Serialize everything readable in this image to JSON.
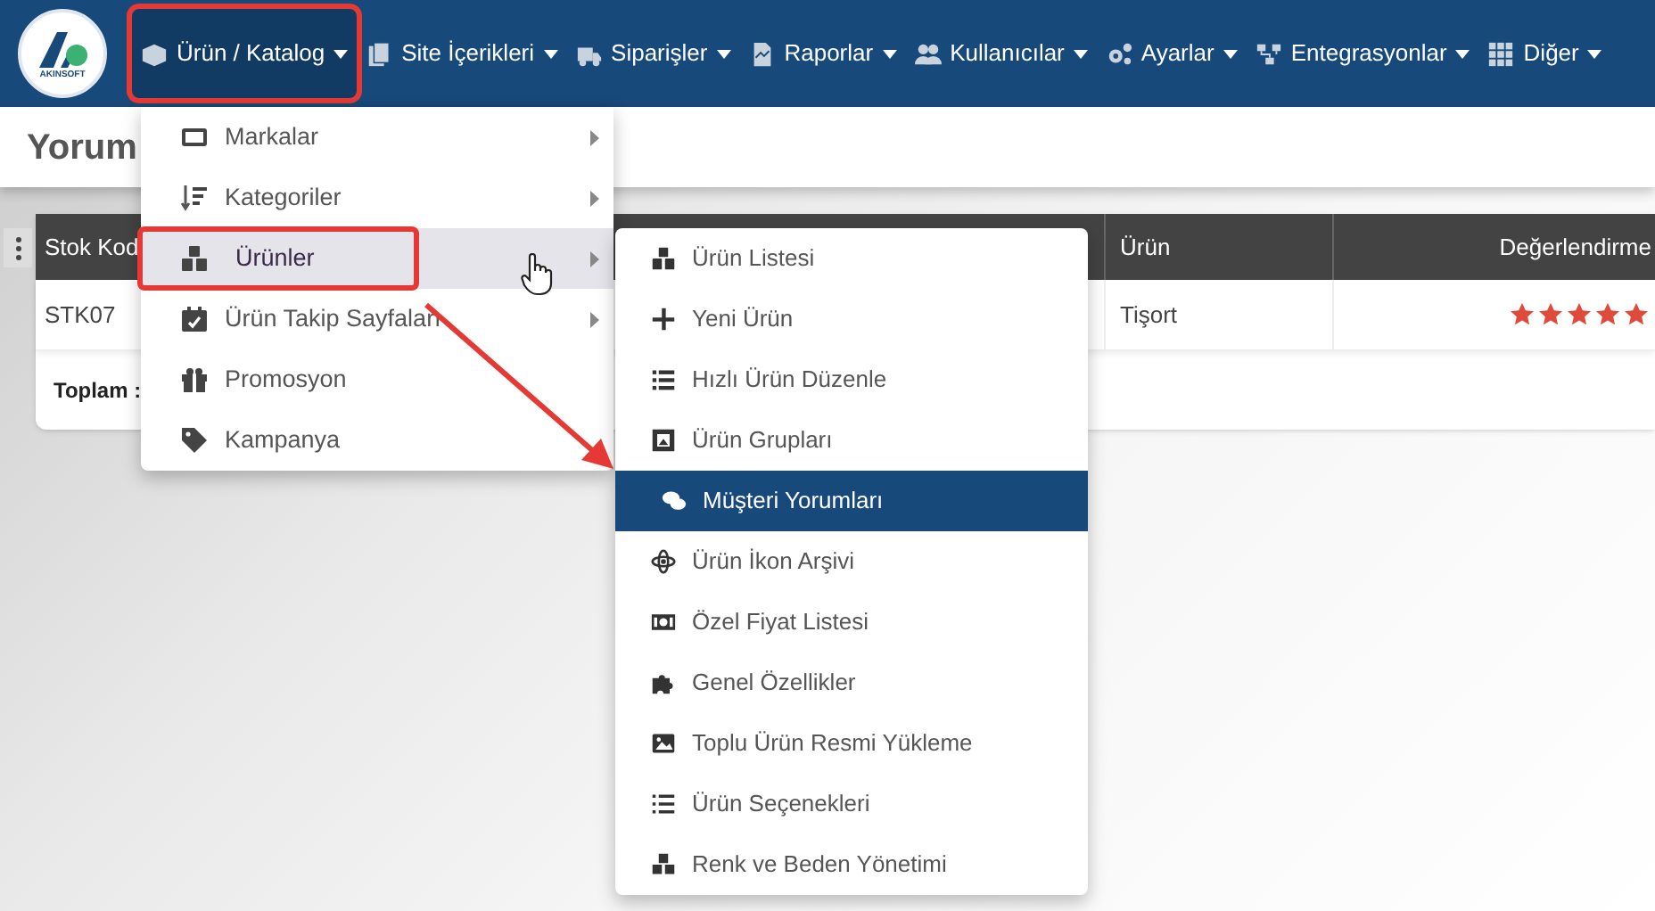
{
  "logo": {
    "text": "AKINSOFT"
  },
  "nav": [
    {
      "label": "Ürün / Katalog",
      "selected": true
    },
    {
      "label": "Site İçerikleri",
      "selected": false
    },
    {
      "label": "Siparişler",
      "selected": false
    },
    {
      "label": "Raporlar",
      "selected": false
    },
    {
      "label": "Kullanıcılar",
      "selected": false
    },
    {
      "label": "Ayarlar",
      "selected": false
    },
    {
      "label": "Entegrasyonlar",
      "selected": false
    },
    {
      "label": "Diğer",
      "selected": false
    }
  ],
  "page_title": "Yorum",
  "table": {
    "columns": [
      "Stok Kod",
      "Ürün",
      "Değerlendirme"
    ],
    "rows": [
      {
        "cells": [
          "STK07",
          "Tişort"
        ],
        "stars": 5
      }
    ],
    "footer": "Toplam :"
  },
  "menu": {
    "items": [
      {
        "label": "Markalar",
        "has_submenu": true,
        "selected": false
      },
      {
        "label": "Kategoriler",
        "has_submenu": true,
        "selected": false
      },
      {
        "label": "Ürünler",
        "has_submenu": true,
        "selected": true
      },
      {
        "label": "Ürün Takip Sayfaları",
        "has_submenu": true,
        "selected": false
      },
      {
        "label": "Promosyon",
        "has_submenu": false,
        "selected": false
      },
      {
        "label": "Kampanya",
        "has_submenu": false,
        "selected": false
      }
    ]
  },
  "submenu": {
    "items": [
      {
        "label": "Ürün Listesi",
        "selected": false
      },
      {
        "label": "Yeni Ürün",
        "selected": false
      },
      {
        "label": "Hızlı Ürün Düzenle",
        "selected": false
      },
      {
        "label": "Ürün Grupları",
        "selected": false
      },
      {
        "label": "Müşteri Yorumları",
        "selected": true
      },
      {
        "label": "Ürün İkon Arşivi",
        "selected": false
      },
      {
        "label": "Özel Fiyat Listesi",
        "selected": false
      },
      {
        "label": "Genel Özellikler",
        "selected": false
      },
      {
        "label": "Toplu Ürün Resmi Yükleme",
        "selected": false
      },
      {
        "label": "Ürün Seçenekleri",
        "selected": false
      },
      {
        "label": "Renk ve Beden Yönetimi",
        "selected": false
      }
    ]
  }
}
